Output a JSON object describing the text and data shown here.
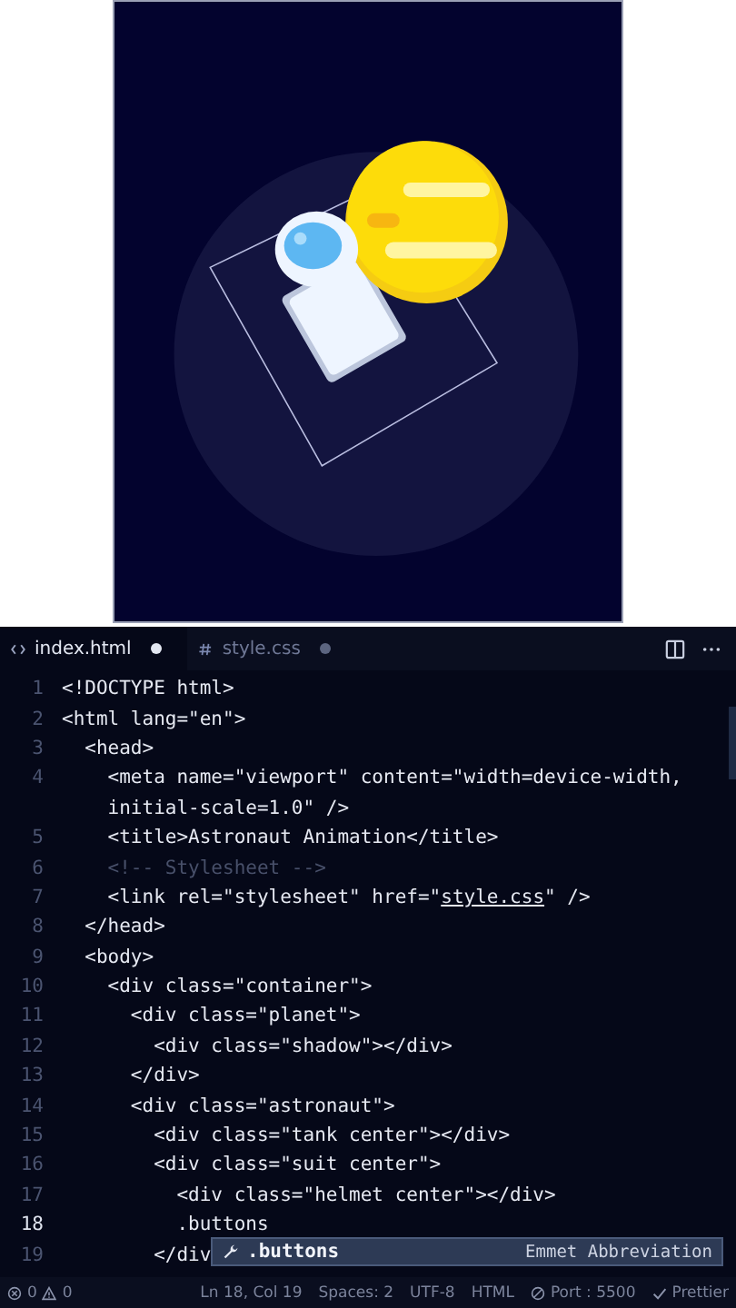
{
  "tabs": [
    {
      "kind": "html",
      "label": "index.html",
      "selected": true,
      "modified": true
    },
    {
      "kind": "css",
      "label": "style.css",
      "selected": false,
      "modified": true
    }
  ],
  "editor": {
    "lines": [
      {
        "number": "1",
        "segments": [
          {
            "kind": "code",
            "text": "<!DOCTYPE html>"
          }
        ]
      },
      {
        "number": "2",
        "segments": [
          {
            "kind": "code",
            "text": "<html lang=\"en\">"
          }
        ]
      },
      {
        "number": "3",
        "segments": [
          {
            "kind": "code",
            "text": "  <head>"
          }
        ]
      },
      {
        "number": "4",
        "segments": [
          {
            "kind": "code",
            "text": "    <meta name=\"viewport\" content=\"width=device-width,"
          }
        ]
      },
      {
        "segments": [
          {
            "kind": "code",
            "text": "    initial-scale=1.0\" />"
          }
        ]
      },
      {
        "number": "5",
        "segments": [
          {
            "kind": "code",
            "text": "    <title>Astronaut Animation</title>"
          }
        ]
      },
      {
        "number": "6",
        "segments": [
          {
            "kind": "comment",
            "text": "    <!-- Stylesheet -->"
          }
        ]
      },
      {
        "number": "7",
        "segments": [
          {
            "kind": "code",
            "text": "    <link rel=\"stylesheet\" href=\""
          },
          {
            "kind": "link",
            "text": "style.css"
          },
          {
            "kind": "code",
            "text": "\" />"
          }
        ]
      },
      {
        "number": "8",
        "segments": [
          {
            "kind": "code",
            "text": "  </head>"
          }
        ]
      },
      {
        "number": "9",
        "segments": [
          {
            "kind": "code",
            "text": "  <body>"
          }
        ]
      },
      {
        "number": "10",
        "segments": [
          {
            "kind": "code",
            "text": "    <div class=\"container\">"
          }
        ]
      },
      {
        "number": "11",
        "segments": [
          {
            "kind": "code",
            "text": "      <div class=\"planet\">"
          }
        ]
      },
      {
        "number": "12",
        "segments": [
          {
            "kind": "code",
            "text": "        <div class=\"shadow\"></div>"
          }
        ]
      },
      {
        "number": "13",
        "segments": [
          {
            "kind": "code",
            "text": "      </div>"
          }
        ]
      },
      {
        "number": "14",
        "segments": [
          {
            "kind": "code",
            "text": "      <div class=\"astronaut\">"
          }
        ]
      },
      {
        "number": "15",
        "segments": [
          {
            "kind": "code",
            "text": "        <div class=\"tank center\"></div>"
          }
        ]
      },
      {
        "number": "16",
        "segments": [
          {
            "kind": "code",
            "text": "        <div class=\"suit center\">"
          }
        ]
      },
      {
        "number": "17",
        "segments": [
          {
            "kind": "code",
            "text": "          <div class=\"helmet center\"></div>"
          }
        ]
      },
      {
        "number": "18",
        "current": true,
        "segments": [
          {
            "kind": "code",
            "text": "          .buttons"
          }
        ]
      },
      {
        "number": "19",
        "segments": [
          {
            "kind": "code",
            "text": "        </div"
          }
        ]
      }
    ]
  },
  "suggestion": {
    "label": ".buttons",
    "detail": "Emmet Abbreviation"
  },
  "status_bar": {
    "errors": "0",
    "warnings": "0",
    "items": [
      {
        "kind": "text",
        "text": "Ln 18, Col 19"
      },
      {
        "kind": "text",
        "text": "Spaces: 2"
      },
      {
        "kind": "text",
        "text": "UTF-8"
      },
      {
        "kind": "text",
        "text": "HTML"
      },
      {
        "kind": "port",
        "text": "Port : 5500"
      },
      {
        "kind": "check",
        "text": "Prettier"
      }
    ]
  }
}
